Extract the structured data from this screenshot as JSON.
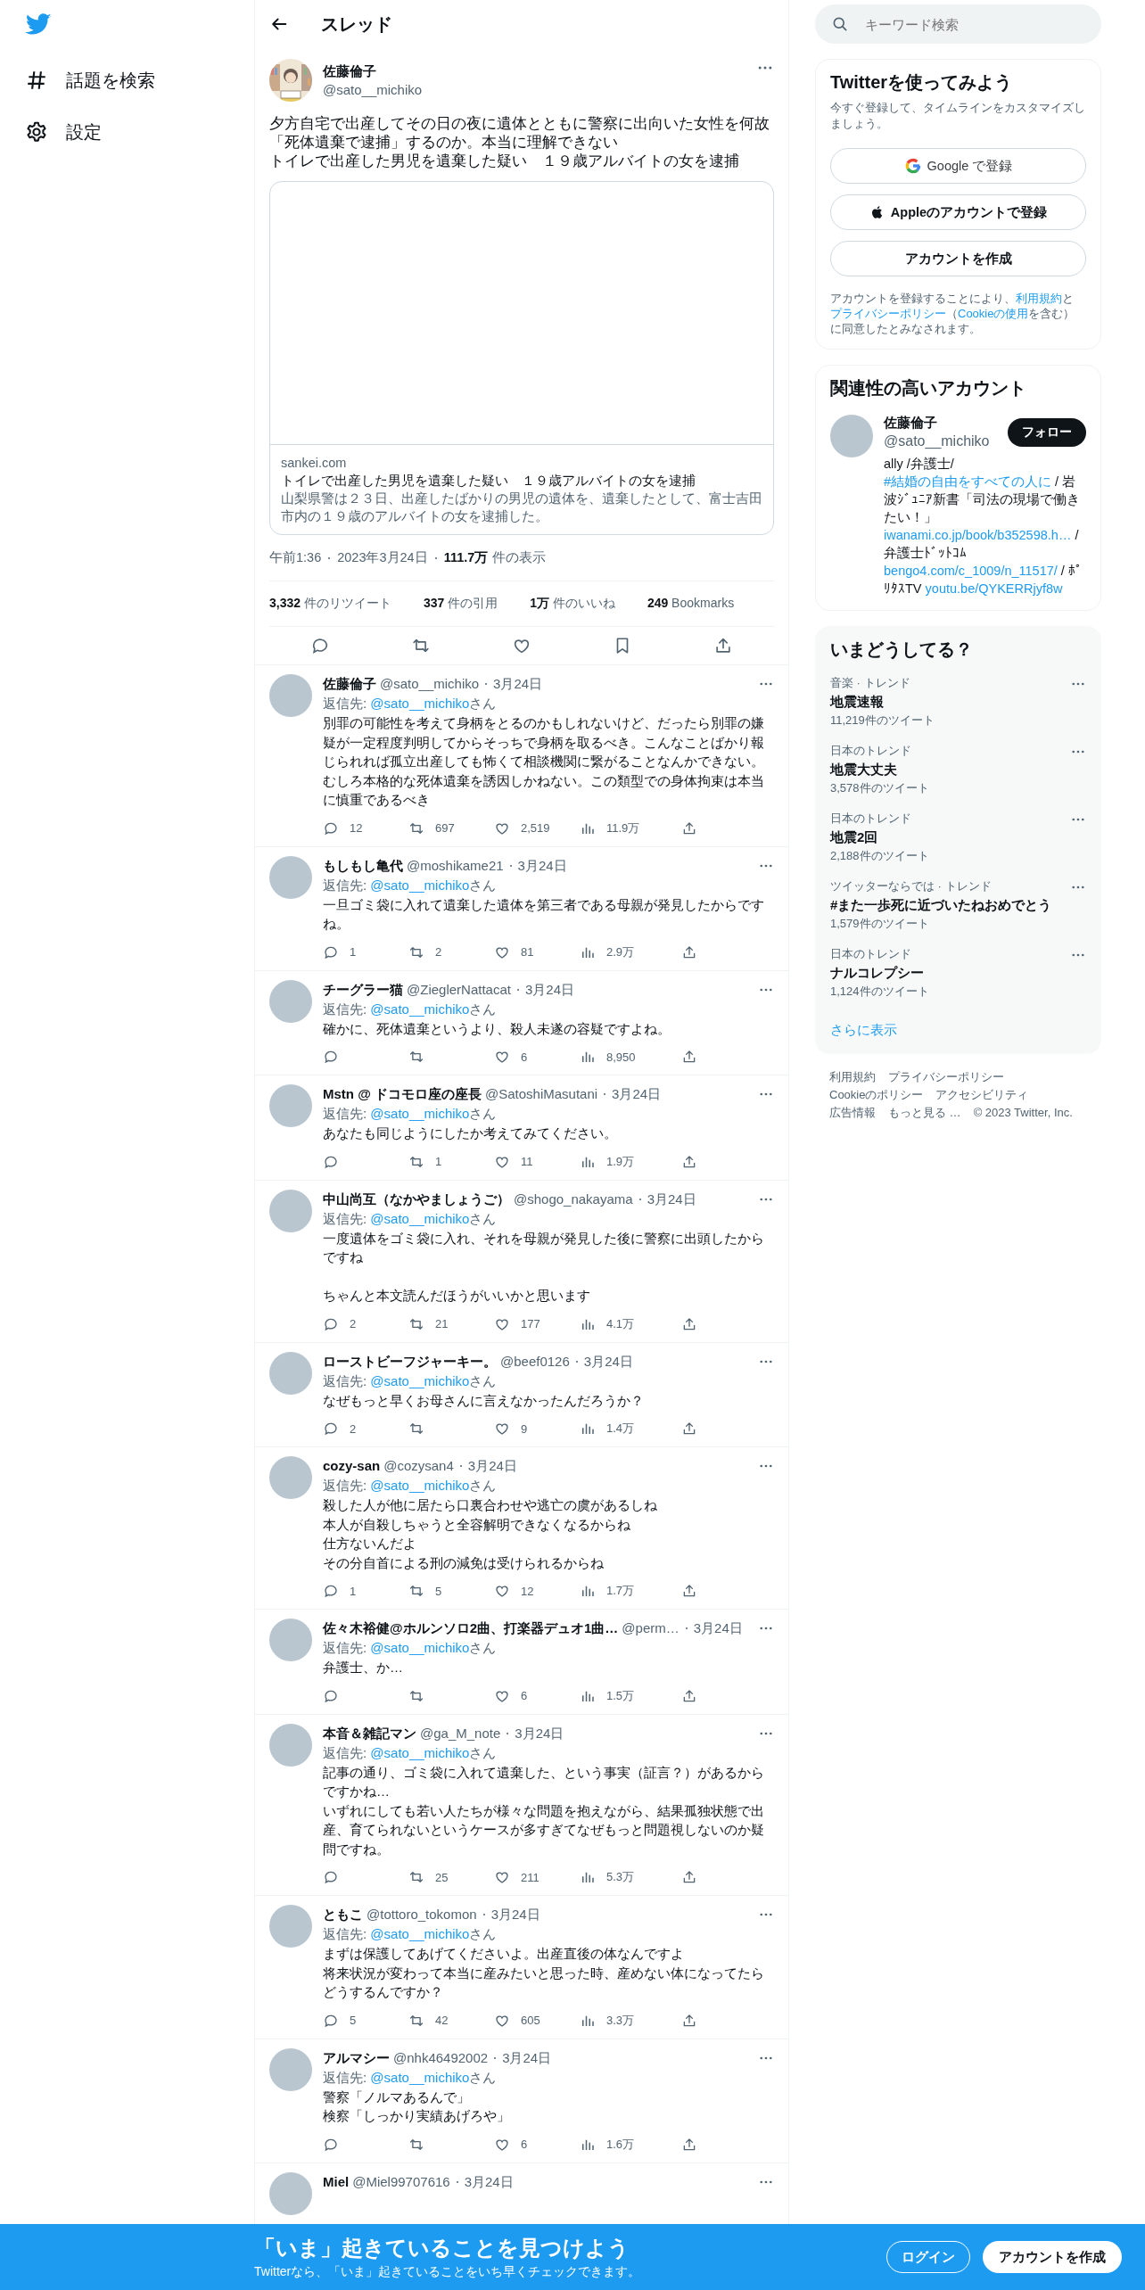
{
  "nav": {
    "items": [
      {
        "kind": "explore",
        "label": "話題を検索"
      },
      {
        "kind": "settings",
        "label": "設定"
      }
    ]
  },
  "header": {
    "title": "スレッド"
  },
  "tweet": {
    "name": "佐藤倫子",
    "handle": "@sato__michiko",
    "lines": [
      "夕方自宅で出産してその日の夜に遺体とともに警察に出向いた女性を何故「死体遺棄で逮捕」するのか。本当に理解できない",
      "トイレで出産した男児を遺棄した疑い　１９歳アルバイトの女を逮捕"
    ],
    "card": {
      "domain": "sankei.com",
      "title": "トイレで出産した男児を遺棄した疑い　１９歳アルバイトの女を逮捕",
      "description": "山梨県警は２３日、出産したばかりの男児の遺体を、遺棄したとして、富士吉田市内の１９歳のアルバイトの女を逮捕した。"
    },
    "time": "午前1:36",
    "date": "2023年3月24日",
    "views": "111.7万",
    "views_label": "件の表示",
    "stats": [
      "**3,332** 件のリツイート",
      "**337** 件の引用",
      "**1万** 件のいいね",
      "**249** Bookmarks"
    ]
  },
  "replies": [
    {
      "name": "佐藤倫子",
      "handle": "@sato__michiko",
      "date": "3月24日",
      "reply_to": [
        {
          "kind": "text",
          "text": "返信先: "
        },
        {
          "kind": "link",
          "text": "@sato__michiko"
        },
        {
          "kind": "text",
          "text": "さん"
        }
      ],
      "paragraphs": [
        [
          "別罪の可能性を考えて身柄をとるのかもしれないけど、だったら別罪の嫌疑が一定程度判明してからそっちで身柄を取るべき。こんなことばかり報じられれば孤立出産しても怖くて相談機関に繋がることなんかできない。むしろ本格的な死体遺棄を誘因しかねない。この類型での身体拘束は本当に慎重であるべき"
        ]
      ],
      "replies": "12",
      "retweets": "697",
      "likes": "2,519",
      "views": "11.9万"
    },
    {
      "name": "もしもし亀代",
      "handle": "@moshikame21",
      "date": "3月24日",
      "reply_to": [
        {
          "kind": "text",
          "text": "返信先: "
        },
        {
          "kind": "link",
          "text": "@sato__michiko"
        },
        {
          "kind": "text",
          "text": "さん"
        }
      ],
      "paragraphs": [
        [
          "一旦ゴミ袋に入れて遺棄した遺体を第三者である母親が発見したからですね。"
        ]
      ],
      "replies": "1",
      "retweets": "2",
      "likes": "81",
      "views": "2.9万"
    },
    {
      "name": "チーグラー猫",
      "handle": "@ZieglerNattacat",
      "date": "3月24日",
      "reply_to": [
        {
          "kind": "text",
          "text": "返信先: "
        },
        {
          "kind": "link",
          "text": "@sato__michiko"
        },
        {
          "kind": "text",
          "text": "さん"
        }
      ],
      "paragraphs": [
        [
          "確かに、死体遺棄というより、殺人未遂の容疑ですよね。"
        ]
      ],
      "likes": "6",
      "views": "8,950"
    },
    {
      "name": "Mstn @ ドコモロ座の座長",
      "handle": "@SatoshiMasutani",
      "date": "3月24日",
      "reply_to": [
        {
          "kind": "text",
          "text": "返信先: "
        },
        {
          "kind": "link",
          "text": "@sato__michiko"
        },
        {
          "kind": "text",
          "text": "さん"
        }
      ],
      "paragraphs": [
        [
          "あなたも同じようにしたか考えてみてください。"
        ]
      ],
      "retweets": "1",
      "likes": "11",
      "views": "1.9万"
    },
    {
      "name": "中山尚互（なかやましょうご）",
      "handle": "@shogo_nakayama",
      "date": "3月24日",
      "reply_to": [
        {
          "kind": "text",
          "text": "返信先: "
        },
        {
          "kind": "link",
          "text": "@sato__michiko"
        },
        {
          "kind": "text",
          "text": "さん"
        }
      ],
      "paragraphs": [
        [
          "一度遺体をゴミ袋に入れ、それを母親が発見した後に警察に出頭したからですね"
        ],
        [
          "ちゃんと本文読んだほうがいいかと思います"
        ]
      ],
      "replies": "2",
      "retweets": "21",
      "likes": "177",
      "views": "4.1万"
    },
    {
      "name": "ローストビーフジャーキー。",
      "handle": "@beef0126",
      "date": "3月24日",
      "reply_to": [
        {
          "kind": "text",
          "text": "返信先: "
        },
        {
          "kind": "link",
          "text": "@sato__michiko"
        },
        {
          "kind": "text",
          "text": "さん"
        }
      ],
      "paragraphs": [
        [
          "なぜもっと早くお母さんに言えなかったんだろうか？"
        ]
      ],
      "replies": "2",
      "likes": "9",
      "views": "1.4万"
    },
    {
      "name": "cozy-san",
      "handle": "@cozysan4",
      "date": "3月24日",
      "reply_to": [
        {
          "kind": "text",
          "text": "返信先: "
        },
        {
          "kind": "link",
          "text": "@sato__michiko"
        },
        {
          "kind": "text",
          "text": "さん"
        }
      ],
      "paragraphs": [
        [
          "殺した人が他に居たら口裏合わせや逃亡の虞があるしね",
          "本人が自殺しちゃうと全容解明できなくなるからね",
          "仕方ないんだよ",
          "その分自首による刑の減免は受けられるからね"
        ]
      ],
      "replies": "1",
      "retweets": "5",
      "likes": "12",
      "views": "1.7万"
    },
    {
      "name": "佐々木裕健@ホルンソロ2曲、打楽器デュオ1曲…",
      "handle": "@perm…",
      "date": "3月24日",
      "reply_to": [
        {
          "kind": "text",
          "text": "返信先: "
        },
        {
          "kind": "link",
          "text": "@sato__michiko"
        },
        {
          "kind": "text",
          "text": "さん"
        }
      ],
      "paragraphs": [
        [
          "弁護士、か…"
        ]
      ],
      "likes": "6",
      "views": "1.5万"
    },
    {
      "name": "本音＆雑記マン",
      "handle": "@ga_M_note",
      "date": "3月24日",
      "reply_to": [
        {
          "kind": "text",
          "text": "返信先: "
        },
        {
          "kind": "link",
          "text": "@sato__michiko"
        },
        {
          "kind": "text",
          "text": "さん"
        }
      ],
      "paragraphs": [
        [
          "記事の通り、ゴミ袋に入れて遺棄した、という事実（証言？）があるからですかね…",
          "いずれにしても若い人たちが様々な問題を抱えながら、結果孤独状態で出産、育てられないというケースが多すぎてなぜもっと問題視しないのか疑問ですね。"
        ]
      ],
      "retweets": "25",
      "likes": "211",
      "views": "5.3万"
    },
    {
      "name": "ともこ",
      "handle": "@tottoro_tokomon",
      "date": "3月24日",
      "reply_to": [
        {
          "kind": "text",
          "text": "返信先: "
        },
        {
          "kind": "link",
          "text": "@sato__michiko"
        },
        {
          "kind": "text",
          "text": "さん"
        }
      ],
      "paragraphs": [
        [
          "まずは保護してあげてくださいよ。出産直後の体なんですよ",
          "将来状況が変わって本当に産みたいと思った時、産めない体になってたらどうするんですか？"
        ]
      ],
      "replies": "5",
      "retweets": "42",
      "likes": "605",
      "views": "3.3万"
    },
    {
      "name": "アルマシー",
      "handle": "@nhk46492002",
      "date": "3月24日",
      "reply_to": [
        {
          "kind": "text",
          "text": "返信先: "
        },
        {
          "kind": "link",
          "text": "@sato__michiko"
        },
        {
          "kind": "text",
          "text": "さん"
        }
      ],
      "paragraphs": [
        [
          "警察「ノルマあるんで」",
          "検察「しっかり実績あげろや」"
        ]
      ],
      "likes": "6",
      "views": "1.6万"
    },
    {
      "name": "Miel",
      "handle": "@Miel99707616",
      "date": "3月24日"
    }
  ],
  "search": {
    "placeholder": "キーワード検索"
  },
  "signup": {
    "title": "Twitterを使ってみよう",
    "subtitle": "今すぐ登録して、タイムラインをカスタマイズしましょう。",
    "buttons": [
      {
        "kind": "google",
        "label": "Google で登録"
      },
      {
        "kind": "apple",
        "label": "Appleのアカウントで登録"
      },
      {
        "kind": "plain",
        "label": "アカウントを作成"
      }
    ],
    "terms": [
      {
        "kind": "text",
        "text": "アカウントを登録することにより、"
      },
      {
        "kind": "link",
        "text": "利用規約"
      },
      {
        "kind": "text",
        "text": "と"
      },
      {
        "kind": "link",
        "text": "プライバシーポリシー"
      },
      {
        "kind": "text",
        "text": "（"
      },
      {
        "kind": "link",
        "text": "Cookieの使用"
      },
      {
        "kind": "text",
        "text": "を含む）に同意したとみなされます。"
      }
    ]
  },
  "related": {
    "title": "関連性の高いアカウント",
    "name": "佐藤倫子",
    "handle": "@sato__michiko",
    "follow": "フォロー",
    "bio": [
      {
        "kind": "text",
        "text": "ally /弁護士/ "
      },
      {
        "kind": "link",
        "text": "#結婚の自由をすべての人に"
      },
      {
        "kind": "text",
        "text": " / 岩波ｼﾞｭﾆｱ新書「司法の現場で働きたい！」"
      },
      {
        "kind": "link",
        "text": "iwanami.co.jp/book/b352598.h…"
      },
      {
        "kind": "text",
        "text": " / 弁護士ﾄﾞｯﾄｺﾑ "
      },
      {
        "kind": "link",
        "text": "bengo4.com/c_1009/n_11517/"
      },
      {
        "kind": "text",
        "text": " / ﾎﾟﾘﾀｽTV "
      },
      {
        "kind": "link",
        "text": "youtu.be/QYKERRjyf8w"
      }
    ]
  },
  "trends": {
    "title": "いまどうしてる？",
    "items": [
      {
        "category": "音楽 · トレンド",
        "title": "地震速報",
        "count": "11,219件のツイート"
      },
      {
        "category": "日本のトレンド",
        "title": "地震大丈夫",
        "count": "3,578件のツイート"
      },
      {
        "category": "日本のトレンド",
        "title": "地震2回",
        "count": "2,188件のツイート"
      },
      {
        "category": "ツイッターならでは · トレンド",
        "title": "#また一歩死に近づいたねおめでとう",
        "count": "1,579件のツイート"
      },
      {
        "category": "日本のトレンド",
        "title": "ナルコレプシー",
        "count": "1,124件のツイート"
      }
    ],
    "more": "さらに表示"
  },
  "footer": {
    "links": [
      "利用規約",
      "プライバシーポリシー",
      "Cookieのポリシー",
      "アクセシビリティ",
      "広告情報",
      "もっと見る …"
    ],
    "copyright": "© 2023 Twitter, Inc."
  },
  "banner": {
    "title": "「いま」起きていることを見つけよう",
    "subtitle": "Twitterなら、「いま」起きていることをいち早くチェックできます。",
    "login": "ログイン",
    "signup": "アカウントを作成"
  }
}
